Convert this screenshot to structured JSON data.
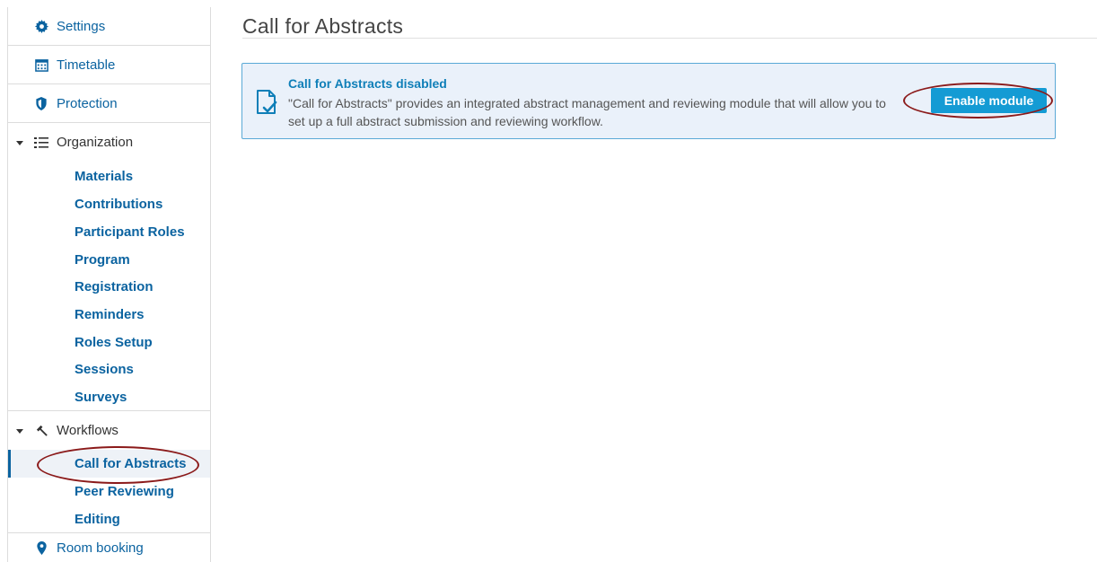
{
  "sidebar": {
    "settings": "Settings",
    "timetable": "Timetable",
    "protection": "Protection",
    "organization": {
      "label": "Organization",
      "items": [
        "Materials",
        "Contributions",
        "Participant Roles",
        "Program",
        "Registration",
        "Reminders",
        "Roles Setup",
        "Sessions",
        "Surveys"
      ]
    },
    "workflows": {
      "label": "Workflows",
      "items": [
        "Call for Abstracts",
        "Peer Reviewing",
        "Editing"
      ]
    },
    "room_booking": "Room booking"
  },
  "main": {
    "title": "Call for Abstracts",
    "notice": {
      "title": "Call for Abstracts disabled",
      "line1": "\"Call for Abstracts\" provides an integrated abstract management and reviewing module that will allow you to",
      "line2": "set up a full abstract submission and reviewing workflow.",
      "button": "Enable module"
    }
  },
  "colors": {
    "link": "#0b63a0",
    "button": "#149bd4",
    "notice_bg": "#eaf1fa",
    "annotation": "#8b1a1a"
  }
}
